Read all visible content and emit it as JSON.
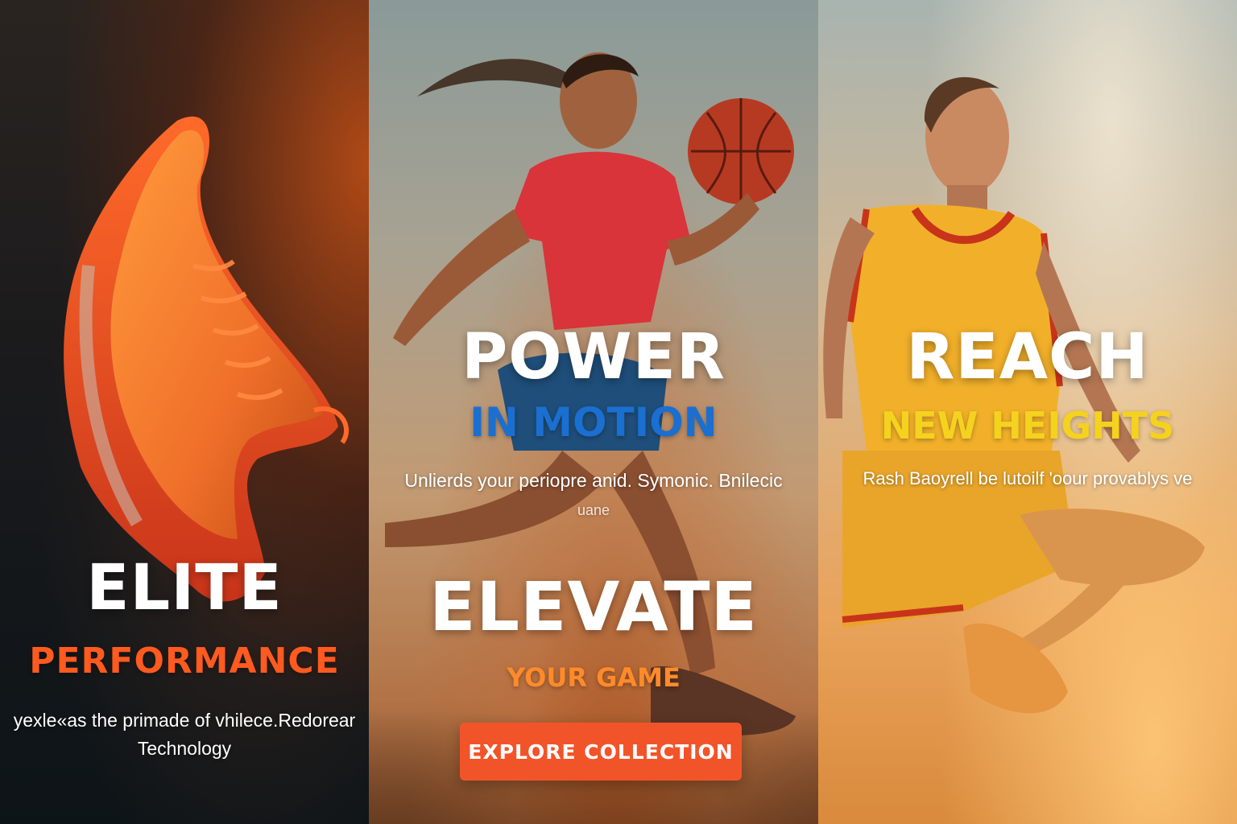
{
  "panels": [
    {
      "headline": "ELITE",
      "subheadline": "PERFORMANCE",
      "body": "yexle«as the primade of vhilece.Redorear Technology",
      "accent_color": "#ff5a1f"
    },
    {
      "headline": "POWER",
      "subheadline": "IN MOTION",
      "body": "Unlierds your periopre anid. Symonic. Bnilecic",
      "body_extra": "uane",
      "headline_2": "ELEVATE",
      "subheadline_2": "YOUR GAME",
      "cta_label": "EXPLORE COLLECTION",
      "accent_color": "#1a6fd0",
      "cta_color": "#f2542a"
    },
    {
      "headline": "REACH",
      "subheadline": "NEW HEIGHTS",
      "body": "Rash Baoyrell be lutoilf 'oour provablys ve",
      "accent_color": "#f5d21e"
    }
  ]
}
